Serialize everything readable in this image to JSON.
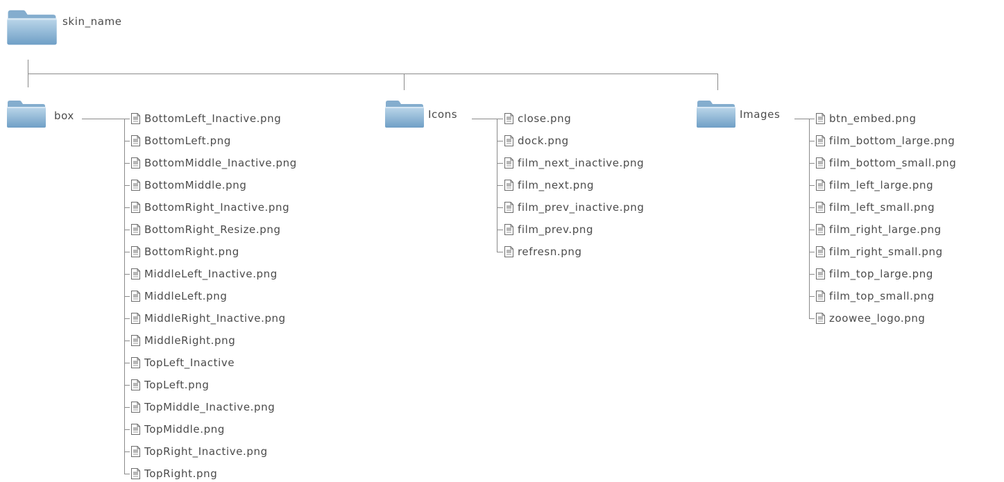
{
  "root": {
    "label": "skin_name"
  },
  "folders": [
    {
      "label": "box",
      "files": [
        "BottomLeft_Inactive.png",
        "BottomLeft.png",
        "BottomMiddle_Inactive.png",
        "BottomMiddle.png",
        "BottomRight_Inactive.png",
        "BottomRight_Resize.png",
        "BottomRight.png",
        "MiddleLeft_Inactive.png",
        "MiddleLeft.png",
        "MiddleRight_Inactive.png",
        "MiddleRight.png",
        "TopLeft_Inactive",
        "TopLeft.png",
        "TopMiddle_Inactive.png",
        "TopMiddle.png",
        "TopRight_Inactive.png",
        "TopRight.png"
      ]
    },
    {
      "label": "Icons",
      "files": [
        "close.png",
        "dock.png",
        "film_next_inactive.png",
        "film_next.png",
        "film_prev_inactive.png",
        "film_prev.png",
        "refresn.png"
      ]
    },
    {
      "label": "Images",
      "files": [
        "btn_embed.png",
        "film_bottom_large.png",
        "film_bottom_small.png",
        "film_left_large.png",
        "film_left_small.png",
        "film_right_large.png",
        "film_right_small.png",
        "film_top_large.png",
        "film_top_small.png",
        "zoowee_logo.png"
      ]
    }
  ],
  "colors": {
    "folder_top": "#bcd7ea",
    "folder_bottom": "#6f9fc6",
    "line": "#8a8a8a",
    "text": "#4b4b4b"
  }
}
